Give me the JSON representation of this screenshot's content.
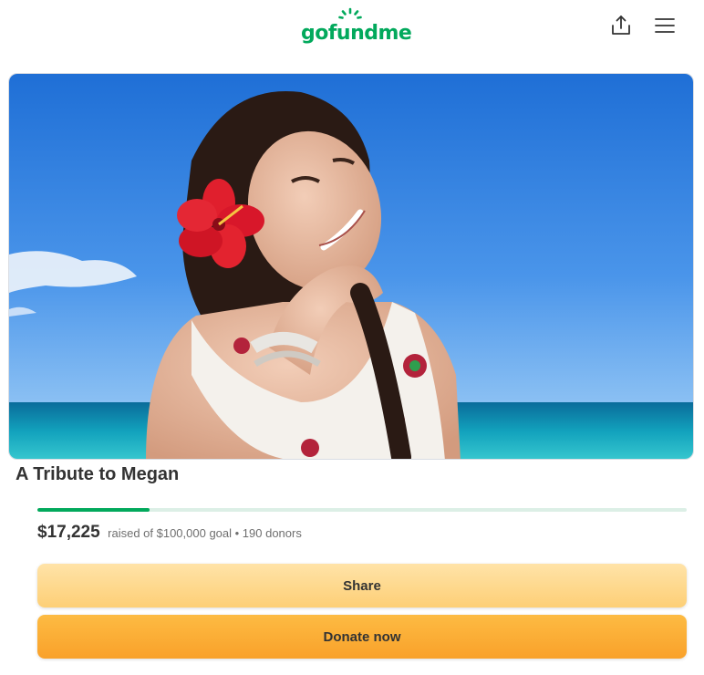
{
  "header": {
    "logo_text": "gofundme",
    "brand_color": "#02a95c",
    "share_icon": "share-upload-icon",
    "menu_icon": "hamburger-menu-icon"
  },
  "campaign": {
    "title": "A Tribute to Megan",
    "raised": "$17,225",
    "raised_text": "raised of $100,000 goal • 190 donors",
    "progress": 0.17225
  },
  "actions": {
    "share_label": "Share",
    "donate_label": "Donate now"
  }
}
